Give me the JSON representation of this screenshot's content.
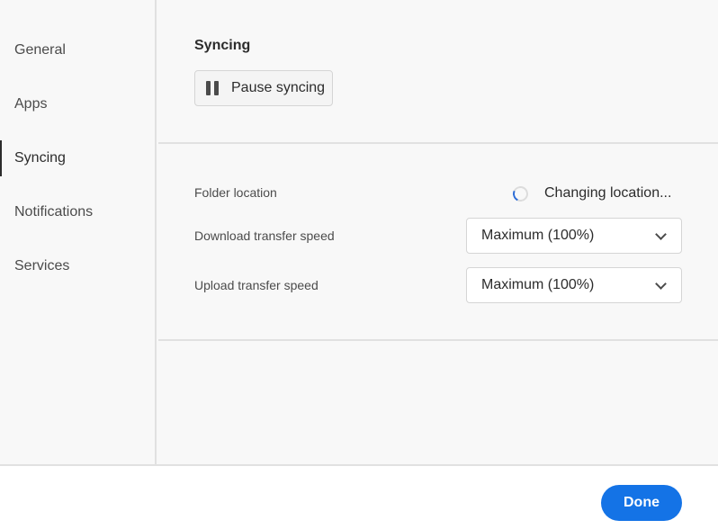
{
  "sidebar": {
    "items": [
      {
        "label": "General"
      },
      {
        "label": "Apps"
      },
      {
        "label": "Syncing"
      },
      {
        "label": "Notifications"
      },
      {
        "label": "Services"
      }
    ],
    "active_index": 2
  },
  "syncing": {
    "title": "Syncing",
    "pause_label": "Pause syncing"
  },
  "settings": {
    "folder_location_label": "Folder location",
    "folder_location_status": "Changing location...",
    "download_label": "Download transfer speed",
    "download_value": "Maximum (100%)",
    "upload_label": "Upload transfer speed",
    "upload_value": "Maximum (100%)"
  },
  "footer": {
    "done_label": "Done"
  },
  "colors": {
    "accent": "#1473e6",
    "sidebar_bg": "#f8f8f8",
    "divider": "#e1e1e1"
  },
  "icons": [
    "pause-icon",
    "spinner-icon",
    "chevron-down-icon"
  ]
}
